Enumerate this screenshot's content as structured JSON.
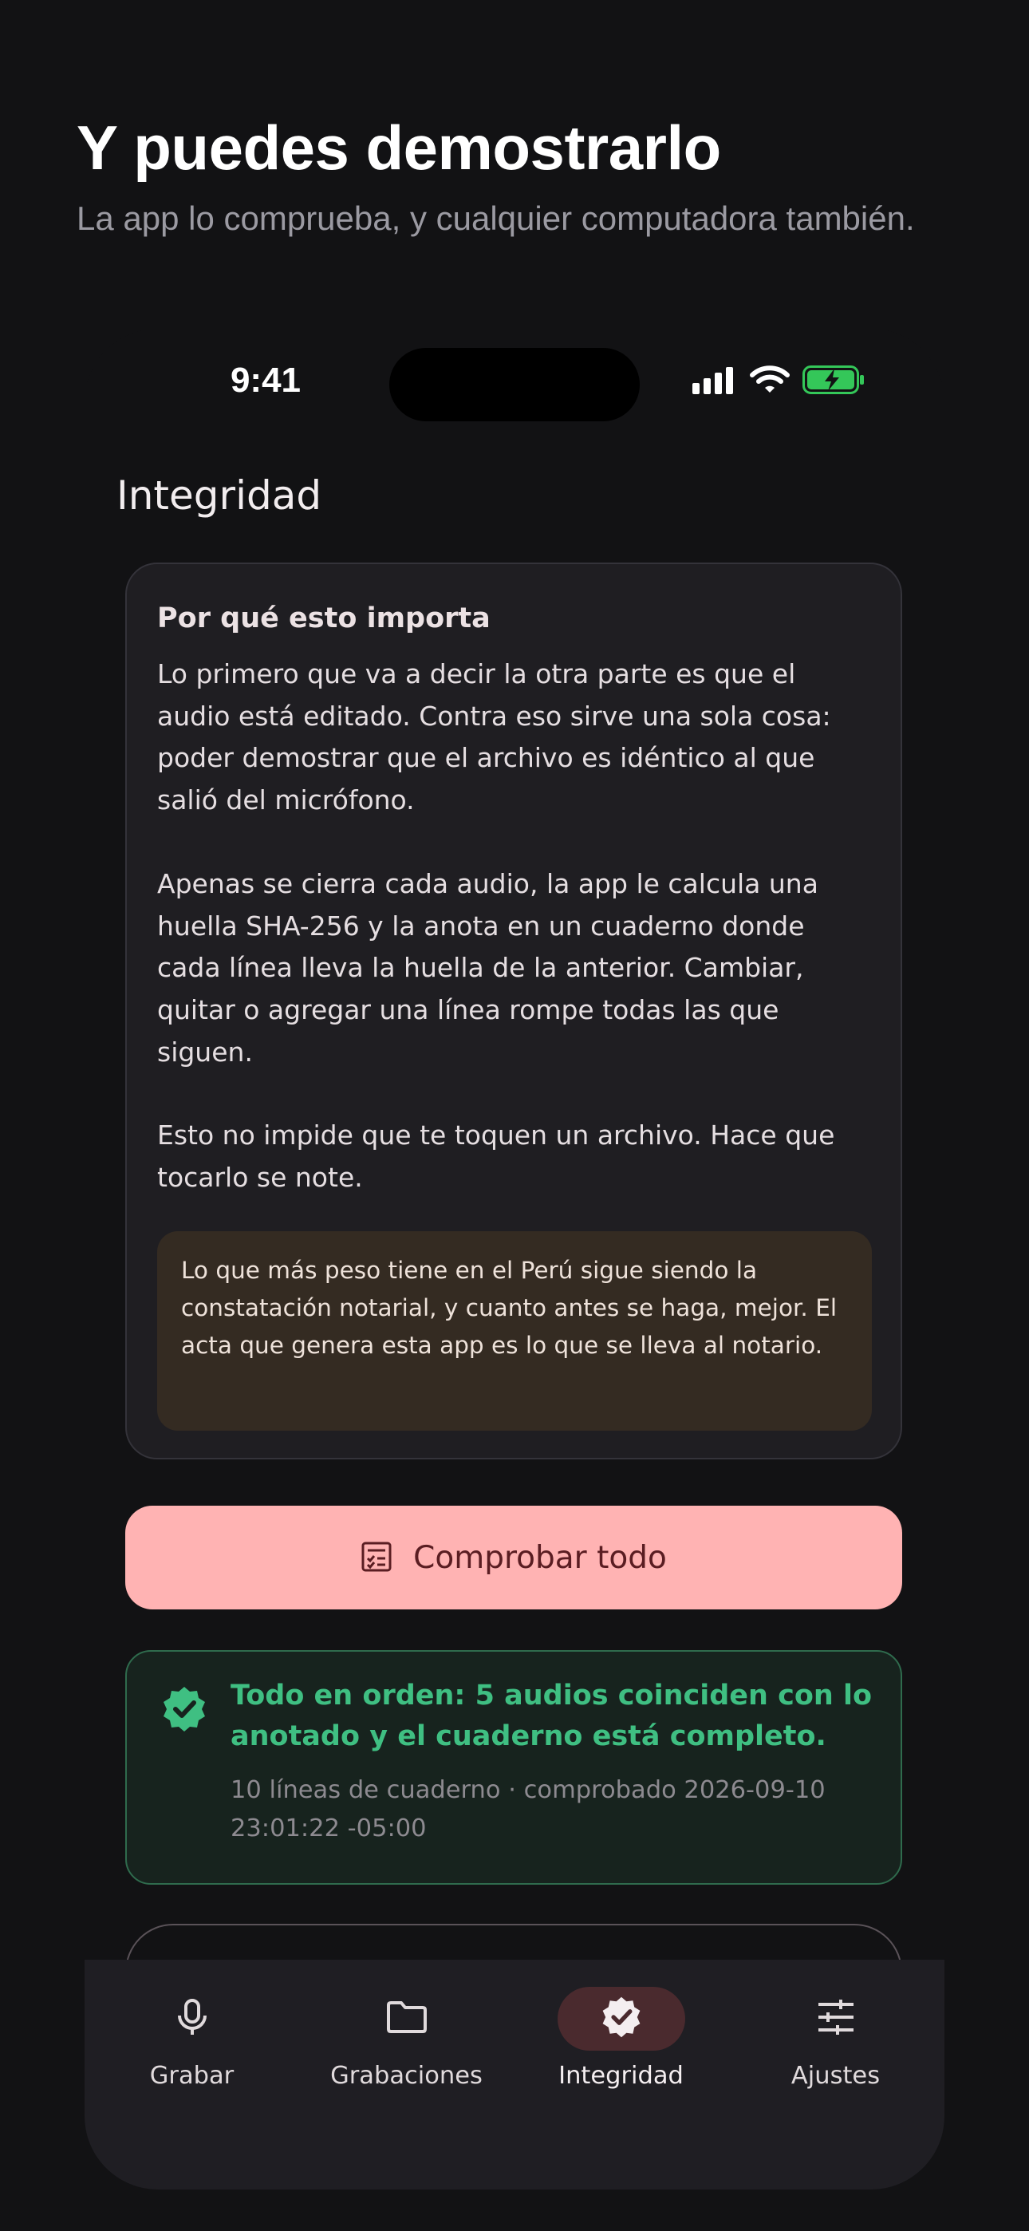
{
  "hero": {
    "title": "Y puedes demostrarlo",
    "subtitle": "La app lo comprueba, y cualquier computadora también."
  },
  "status_bar": {
    "time": "9:41",
    "icons": [
      "signal-icon",
      "wifi-icon",
      "battery-charging-icon"
    ]
  },
  "screen": {
    "title": "Integridad"
  },
  "info_card": {
    "title": "Por qué esto importa",
    "paragraphs": [
      "Lo primero que va a decir la otra parte es que el audio está editado. Contra eso sirve una sola cosa: poder demostrar que el archivo es idéntico al que salió del micrófono.",
      "Apenas se cierra cada audio, la app le calcula una huella SHA-256 y la anota en un cuaderno donde cada línea lleva la huella de la anterior. Cambiar, quitar o agregar una línea rompe todas las que siguen.",
      "Esto no impide que te toquen un archivo. Hace que tocarlo se note."
    ],
    "note": "Lo que más peso tiene en el Perú sigue siendo la constatación notarial, y cuanto antes se haga, mejor. El acta que genera esta app es lo que se lleva al notario."
  },
  "check_button": {
    "label": "Comprobar todo",
    "icon": "checklist-icon"
  },
  "result": {
    "icon": "verified-badge-icon",
    "title": "Todo en orden: 5 audios coinciden con lo anotado y el cuaderno está completo.",
    "meta": "10 líneas de cuaderno · comprobado 2026-09-10 23:01:22 -05:00"
  },
  "nav": {
    "items": [
      {
        "label": "Grabar",
        "icon": "microphone-icon"
      },
      {
        "label": "Grabaciones",
        "icon": "folder-icon"
      },
      {
        "label": "Integridad",
        "icon": "verified-badge-icon"
      },
      {
        "label": "Ajustes",
        "icon": "sliders-icon"
      }
    ],
    "active_index": 2
  },
  "colors": {
    "background": "#121214",
    "card": "#1F1E22",
    "note_background": "#342B22",
    "primary_button": "#FFB3B3",
    "primary_button_text": "#5A1D22",
    "success": "#3FBF82",
    "success_background": "#17231E",
    "nav_active_pill": "#4A2A2E",
    "battery_green": "#34C759"
  }
}
